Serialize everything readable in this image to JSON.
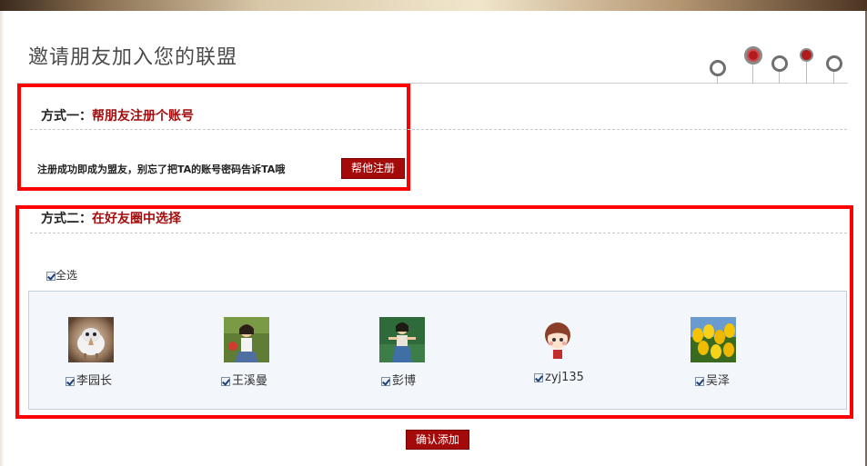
{
  "page": {
    "title": "邀请朋友加入您的联盟"
  },
  "progress_steps": {
    "total": 5,
    "active": [
      2,
      4
    ]
  },
  "method1": {
    "prefix": "方式一：",
    "title": "帮朋友注册个账号",
    "hint": "注册成功即成为盟友，别忘了把TA的账号密码告诉TA哦",
    "button": "帮他注册"
  },
  "method2": {
    "prefix": "方式二：",
    "title": "在好友圈中选择",
    "select_all": "全选",
    "select_all_checked": true,
    "friends": [
      {
        "name": "李园长",
        "checked": true,
        "avatar": "kiwi-bird-avatar"
      },
      {
        "name": "王溪曼",
        "checked": true,
        "avatar": "girl-photo-avatar"
      },
      {
        "name": "彭博",
        "checked": true,
        "avatar": "girl-green-wall-avatar"
      },
      {
        "name": "zyj135",
        "checked": true,
        "avatar": "cartoon-girl-avatar"
      },
      {
        "name": "吴泽",
        "checked": true,
        "avatar": "yellow-tulips-avatar"
      }
    ]
  },
  "confirm_button": "确认添加",
  "colors": {
    "accent_red": "#a30d0d",
    "highlight_box": "#ff0000",
    "panel_bg": "#f3f7fc"
  }
}
